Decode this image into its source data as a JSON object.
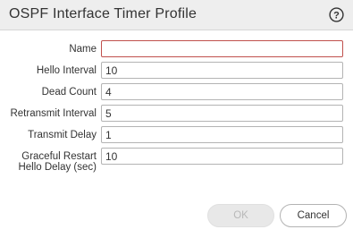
{
  "dialog": {
    "title": "OSPF Interface Timer Profile",
    "help_icon": "help-circle-icon"
  },
  "fields": [
    {
      "label": "Name",
      "value": ""
    },
    {
      "label": "Hello Interval",
      "value": "10"
    },
    {
      "label": "Dead Count",
      "value": "4"
    },
    {
      "label": "Retransmit Interval",
      "value": "5"
    },
    {
      "label": "Transmit Delay",
      "value": "1"
    },
    {
      "label_line1": "Graceful Restart",
      "label_line2": "Hello Delay (sec)",
      "value": "10"
    }
  ],
  "buttons": {
    "ok_label": "OK",
    "cancel_label": "Cancel"
  },
  "colors": {
    "title_bar": "#eeeeee",
    "error_border": "#c0504d",
    "disabled_text": "#b8b8b8"
  }
}
